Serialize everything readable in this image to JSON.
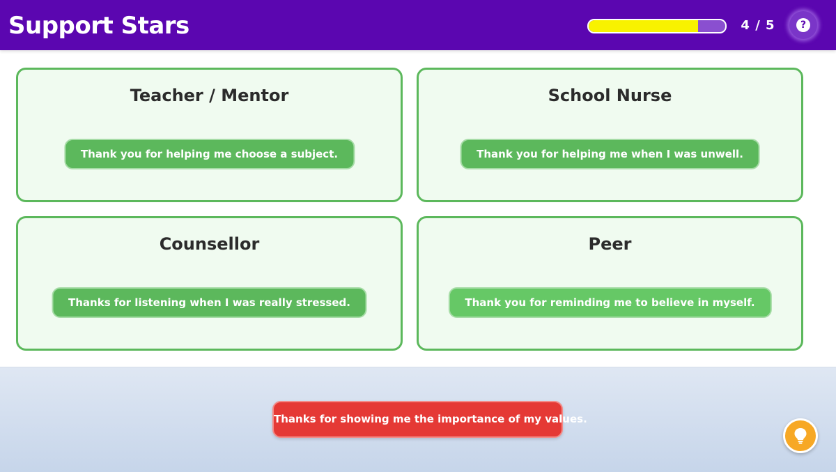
{
  "header": {
    "title": "Support Stars",
    "progress": {
      "current": 4,
      "total": 5,
      "fill_fraction": 0.8
    },
    "counter_text": "4 / 5",
    "help_icon": "question-circle-icon",
    "help_glyph": "?"
  },
  "cards": [
    {
      "title": "Teacher / Mentor",
      "placed_message": "Thank you for helping me choose a subject."
    },
    {
      "title": "School Nurse",
      "placed_message": "Thank you for helping me when I was unwell."
    },
    {
      "title": "Counsellor",
      "placed_message": "Thanks for listening when I was really stressed."
    },
    {
      "title": "Peer",
      "placed_message": "Thank you for reminding me to believe in myself."
    }
  ],
  "tray": {
    "draggable_message": "Thanks for showing me the importance of my values.",
    "hint_icon": "lightbulb-icon"
  },
  "colors": {
    "header_bg": "#5b06b0",
    "progress_fill": "#f8f200",
    "card_border": "#5cb85c",
    "card_bg": "#f0fbf0",
    "chip_green": "#5cb85c",
    "drag_chip_red": "#e53935",
    "hint_orange": "#f7a825"
  }
}
